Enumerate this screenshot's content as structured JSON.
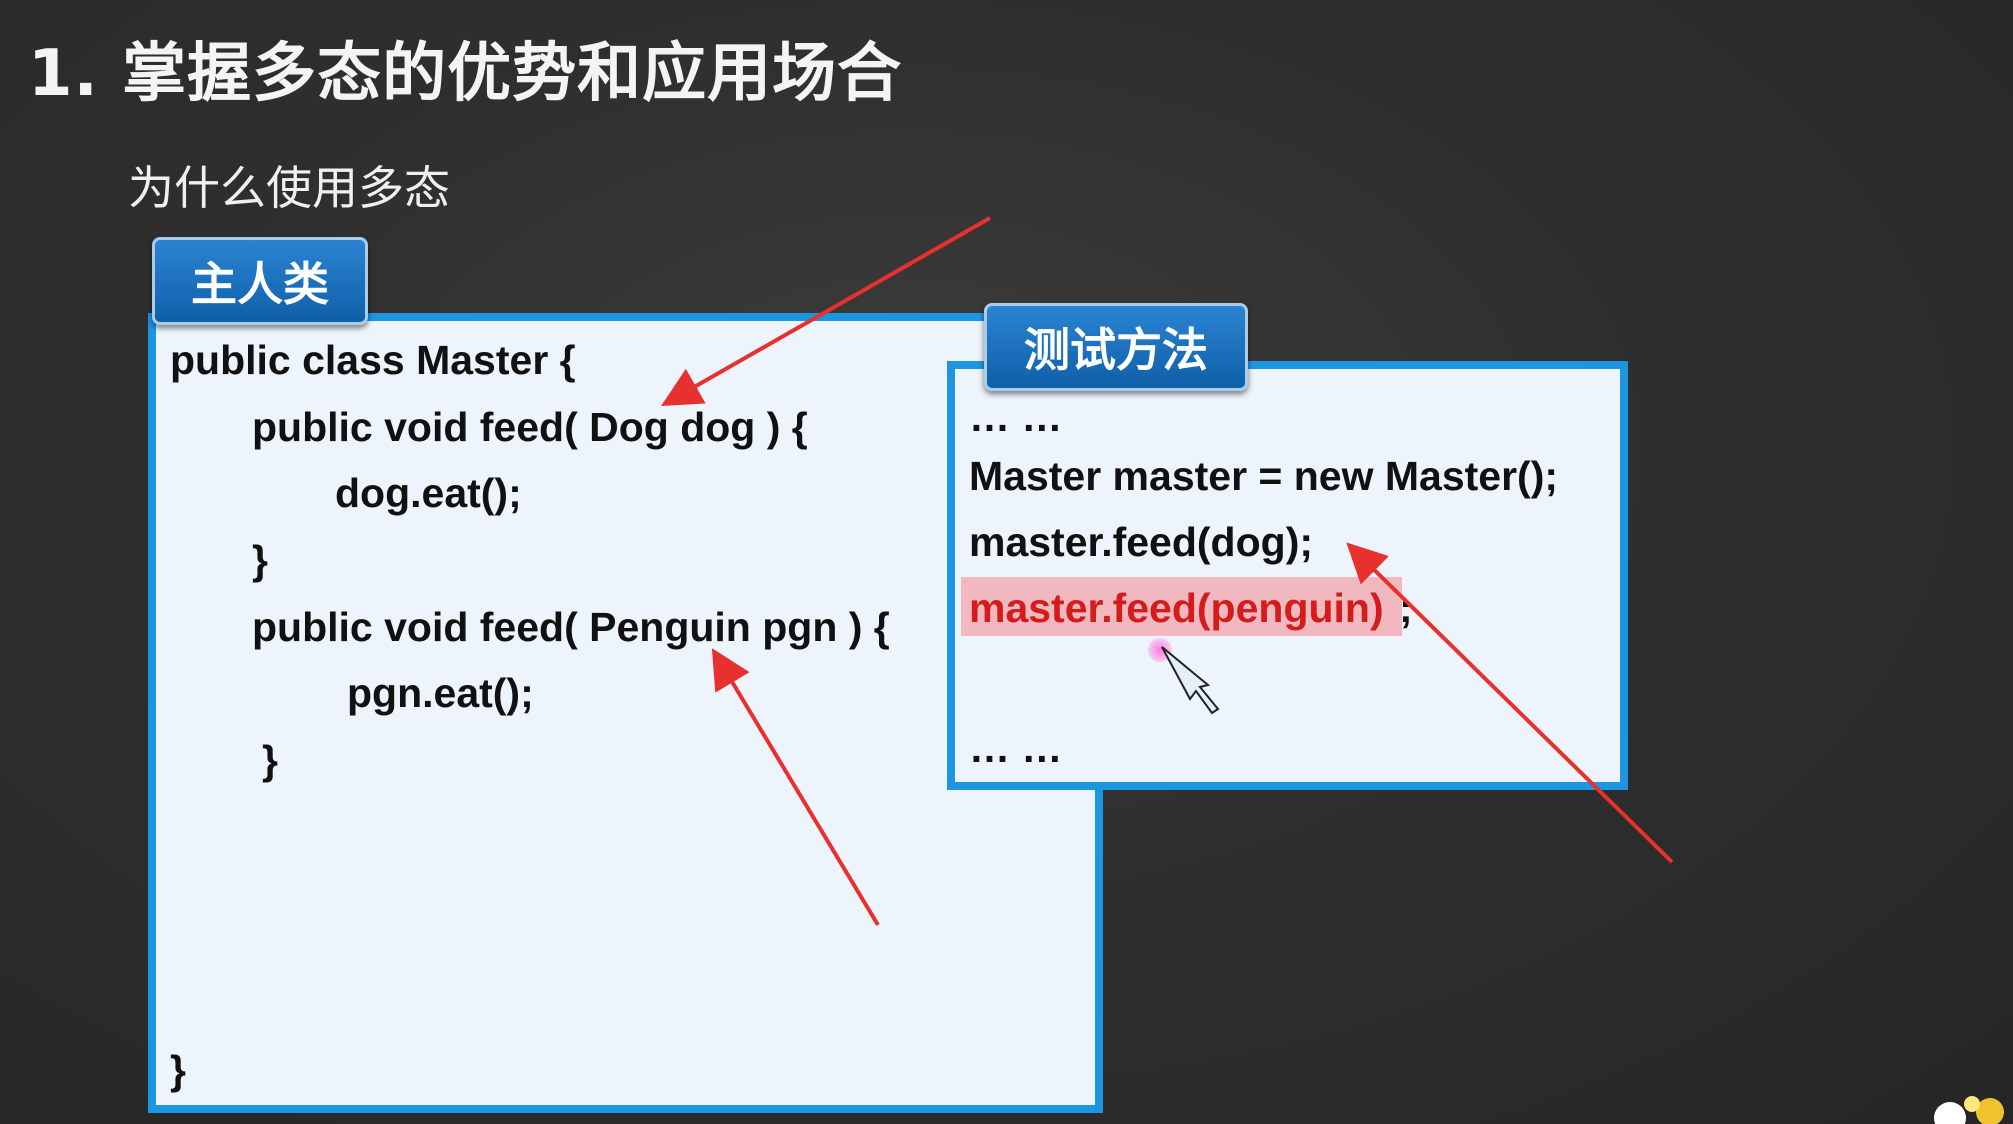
{
  "title": "1. 掌握多态的优势和应用场合",
  "subtitle": "为什么使用多态",
  "master_tab": "主人类",
  "test_tab": "测试方法",
  "master_code": [
    "public class Master {",
    "public void feed( Dog dog ) {",
    "dog.eat();",
    "}",
    "public void feed( Penguin pgn ) {",
    "pgn.eat();",
    "}",
    "}"
  ],
  "test_code": [
    "… …",
    "Master master = new Master();",
    "master.feed(dog);",
    "master.feed(penguin)",
    ";",
    "… …"
  ],
  "colors": {
    "panel_border": "#1d96e2",
    "panel_bg": "#eef4fc",
    "tab_bg": "#1a6fba",
    "arrow": "#e8302e",
    "highlight": "#f2b8bf",
    "highlight_text": "#d41c1c"
  },
  "icons": [
    "pointer-cursor-icon",
    "arrow-annotation"
  ]
}
